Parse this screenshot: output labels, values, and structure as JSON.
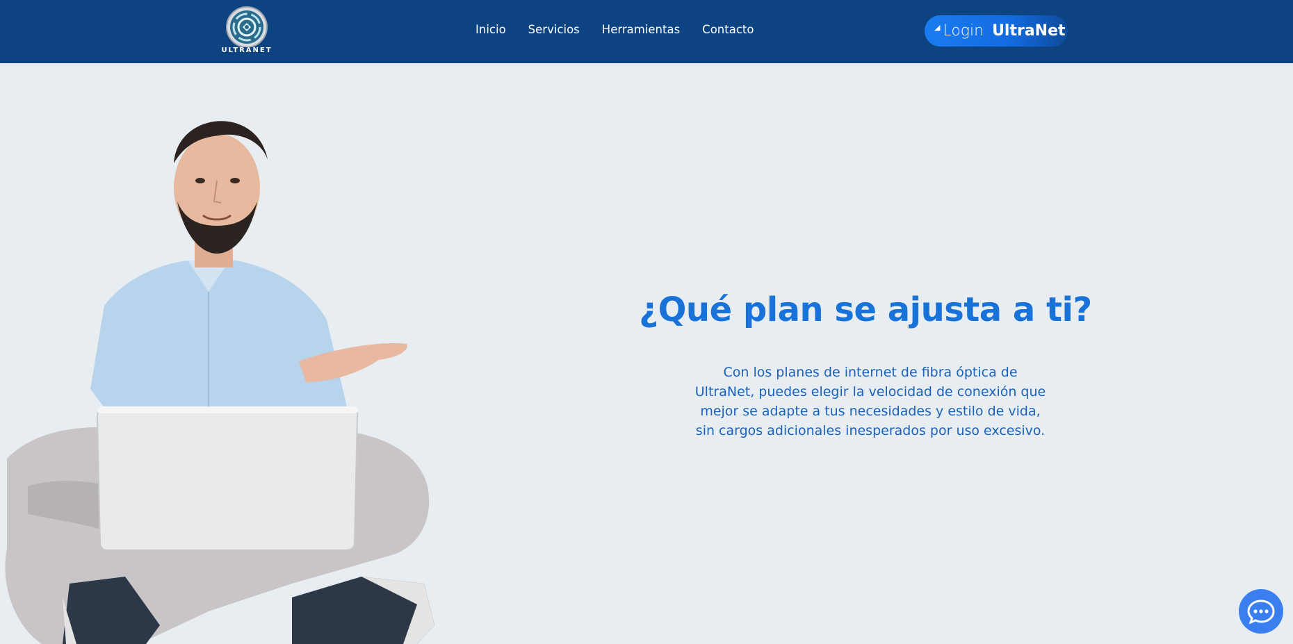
{
  "header": {
    "logo_text": "ULTRANET",
    "nav": [
      "Inicio",
      "Servicios",
      "Herramientas",
      "Contacto"
    ],
    "login_label": "Login",
    "login_brand": "UltraNet"
  },
  "hero": {
    "title": "¿Qué plan se ajusta a ti?",
    "text": "Con los planes de internet de fibra óptica de UltraNet, puedes elegir la velocidad de conexión que mejor se adapte a tus necesidades y estilo de vida, sin cargos adicionales inesperados por uso excesivo."
  },
  "icons": {
    "login": "cursor-arrow-icon",
    "chat": "chat-bubble-icon"
  },
  "colors": {
    "header_bg": "#0d4380",
    "accent": "#1872d8",
    "page_bg": "#e8edf2"
  }
}
